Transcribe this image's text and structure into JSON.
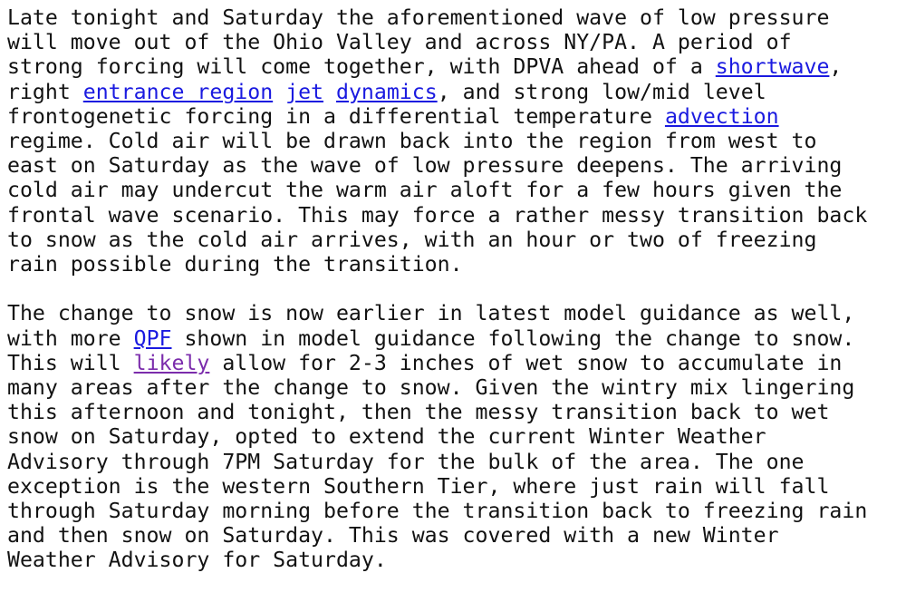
{
  "document": {
    "background_color": "#ffffff",
    "text_color": "#121212",
    "link_color": "#1a1ae0",
    "visited_link_color": "#7b2cac",
    "paragraphs": [
      {
        "id": "paragraph-1",
        "segments": [
          {
            "type": "text",
            "text": "Late tonight and Saturday the aforementioned wave of low pressure\nwill move out of the Ohio Valley and across NY/PA. A period of\nstrong forcing will come together, with DPVA ahead of a "
          },
          {
            "type": "link",
            "text": "shortwave",
            "state": "unvisited"
          },
          {
            "type": "text",
            "text": ",\nright "
          },
          {
            "type": "link",
            "text": "entrance region",
            "state": "unvisited"
          },
          {
            "type": "text",
            "text": " "
          },
          {
            "type": "link",
            "text": "jet",
            "state": "unvisited"
          },
          {
            "type": "text",
            "text": " "
          },
          {
            "type": "link",
            "text": "dynamics",
            "state": "unvisited"
          },
          {
            "type": "text",
            "text": ", and strong low/mid level\nfrontogenetic forcing in a differential temperature "
          },
          {
            "type": "link",
            "text": "advection",
            "state": "unvisited"
          },
          {
            "type": "text",
            "text": "\nregime. Cold air will be drawn back into the region from west to\neast on Saturday as the wave of low pressure deepens. The arriving\ncold air may undercut the warm air aloft for a few hours given the\nfrontal wave scenario. This may force a rather messy transition back\nto snow as the cold air arrives, with an hour or two of freezing\nrain possible during the transition."
          }
        ]
      },
      {
        "id": "paragraph-2",
        "segments": [
          {
            "type": "text",
            "text": "The change to snow is now earlier in latest model guidance as well,\nwith more "
          },
          {
            "type": "link",
            "text": "QPF",
            "state": "unvisited"
          },
          {
            "type": "text",
            "text": " shown in model guidance following the change to snow.\nThis will "
          },
          {
            "type": "link",
            "text": "likely",
            "state": "visited"
          },
          {
            "type": "text",
            "text": " allow for 2-3 inches of wet snow to accumulate in\nmany areas after the change to snow. Given the wintry mix lingering\nthis afternoon and tonight, then the messy transition back to wet\nsnow on Saturday, opted to extend the current Winter Weather\nAdvisory through 7PM Saturday for the bulk of the area. The one\nexception is the western Southern Tier, where just rain will fall\nthrough Saturday morning before the transition back to freezing rain\nand then snow on Saturday. This was covered with a new Winter\nWeather Advisory for Saturday."
          }
        ]
      }
    ]
  }
}
